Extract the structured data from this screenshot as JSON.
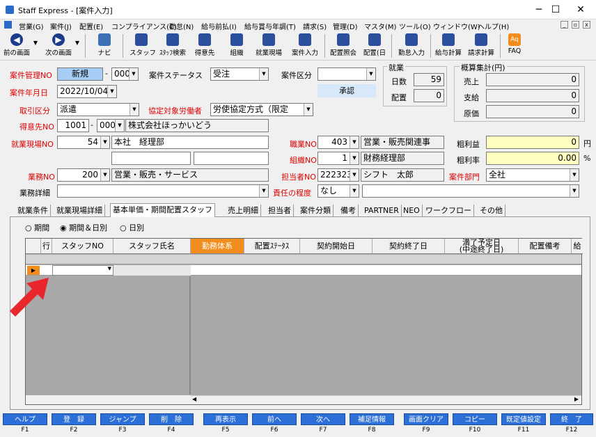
{
  "window": {
    "title": "Staff Express - [案件入力]",
    "min": "─",
    "max": "☐",
    "close": "✕"
  },
  "menu": [
    "営業(G)",
    "案件(J)",
    "配置(E)",
    "コンプライアンス(C)",
    "勤怠(N)",
    "給与前払(I)",
    "給与賞与年調(T)",
    "請求(S)",
    "管理(D)",
    "マスタ(M)",
    "ツール(O)",
    "ウィンドウ(W)",
    "ヘルプ(H)"
  ],
  "toolbar": {
    "prev": "前の画面",
    "next": "次の画面",
    "navi": "ナビ",
    "staff": "スタッフ",
    "staff_search": "ｽﾀｯﾌ検索",
    "customer": "得意先",
    "org": "組織",
    "worksite": "就業現場",
    "case_input": "案件入力",
    "assign_ref": "配置照会",
    "assign_day": "配置(日",
    "attend": "勤怠入力",
    "pay_calc": "給与計算",
    "bill_calc": "請求計算",
    "faq": "FAQ"
  },
  "form": {
    "case_no_label": "案件管理NO",
    "case_no": "新規",
    "case_sub": "000",
    "status_label": "案件ステータス",
    "status": "受注",
    "kubun_label": "案件区分",
    "kubun": "",
    "approve": "承認",
    "date_label": "案件年月日",
    "date": "2022/10/04",
    "torihiki_label": "取引区分",
    "torihiki": "派遣",
    "kyotei_label": "協定対象労働者",
    "kyotei": "労使協定方式（限定",
    "tokui_label": "得意先NO",
    "tokui_no": "1001",
    "tokui_sub": "000",
    "tokui_name": "株式会社ほっかいどう",
    "genba_label": "就業現場NO",
    "genba_no": "54",
    "genba_name": "本社　経理部",
    "shokugyo_label": "職業NO",
    "shokugyo_no": "403",
    "shokugyo_name": "営業・販売関連事",
    "soshiki_label": "組織NO",
    "soshiki_no": "1",
    "soshiki_name": "財務経理部",
    "gyomu_label": "業務NO",
    "gyomu_no": "200",
    "gyomu_name": "営業・販売・サービス",
    "tanto_label": "担当者NO",
    "tanto_no": "222323",
    "tanto_name": "シフト　太郎",
    "bumon_label": "案件部門",
    "bumon": "全社",
    "shosai_label": "業務詳細",
    "sekinin_label": "責任の程度",
    "sekinin": "なし"
  },
  "shugyo": {
    "title": "就業",
    "days_label": "日数",
    "days": "59",
    "haichi_label": "配置",
    "haichi": "0"
  },
  "gaisan": {
    "title": "概算集計(円)",
    "uriage_label": "売上",
    "uriage": "0",
    "shikyu_label": "支給",
    "shikyu": "0",
    "genka_label": "原価",
    "genka": "0",
    "arari_label": "粗利益",
    "arari": "0",
    "arari_unit": "円",
    "rate_label": "粗利率",
    "rate": "0.00",
    "rate_unit": "%"
  },
  "tabs": [
    "就業条件",
    "就業現場詳細",
    "基本単価・期間配置スタッフ",
    "売上明細",
    "担当者",
    "案件分類",
    "備考",
    "PARTNER",
    "NEO",
    "ワークフロー",
    "その他"
  ],
  "radios": {
    "kikan": "期間",
    "kikan_day": "期間＆日別",
    "day": "日別"
  },
  "grid": {
    "headers": [
      "行",
      "スタッフNO",
      "スタッフ氏名",
      "勤務体系",
      "配置ｽﾃｰﾀｽ",
      "契約開始日",
      "契約終了日",
      "満了予定日\n(中途終了日)",
      "配置備考",
      "給"
    ]
  },
  "fkeys": [
    {
      "label": "ヘルプ",
      "key": "F1"
    },
    {
      "label": "登　録",
      "key": "F2"
    },
    {
      "label": "ジャンプ",
      "key": "F3"
    },
    {
      "label": "削　除",
      "key": "F4"
    },
    {
      "label": "再表示",
      "key": "F5"
    },
    {
      "label": "前へ",
      "key": "F6"
    },
    {
      "label": "次へ",
      "key": "F7"
    },
    {
      "label": "補足情報",
      "key": "F8"
    },
    {
      "label": "画面クリア",
      "key": "F9"
    },
    {
      "label": "コピー",
      "key": "F10"
    },
    {
      "label": "既定値設定",
      "key": "F11"
    },
    {
      "label": "終　了",
      "key": "F12"
    }
  ],
  "colors": {
    "accent_blue": "#2c6fd6",
    "orange": "#f28c1c",
    "red_label": "#e00000",
    "arrow": "#e8262b"
  }
}
